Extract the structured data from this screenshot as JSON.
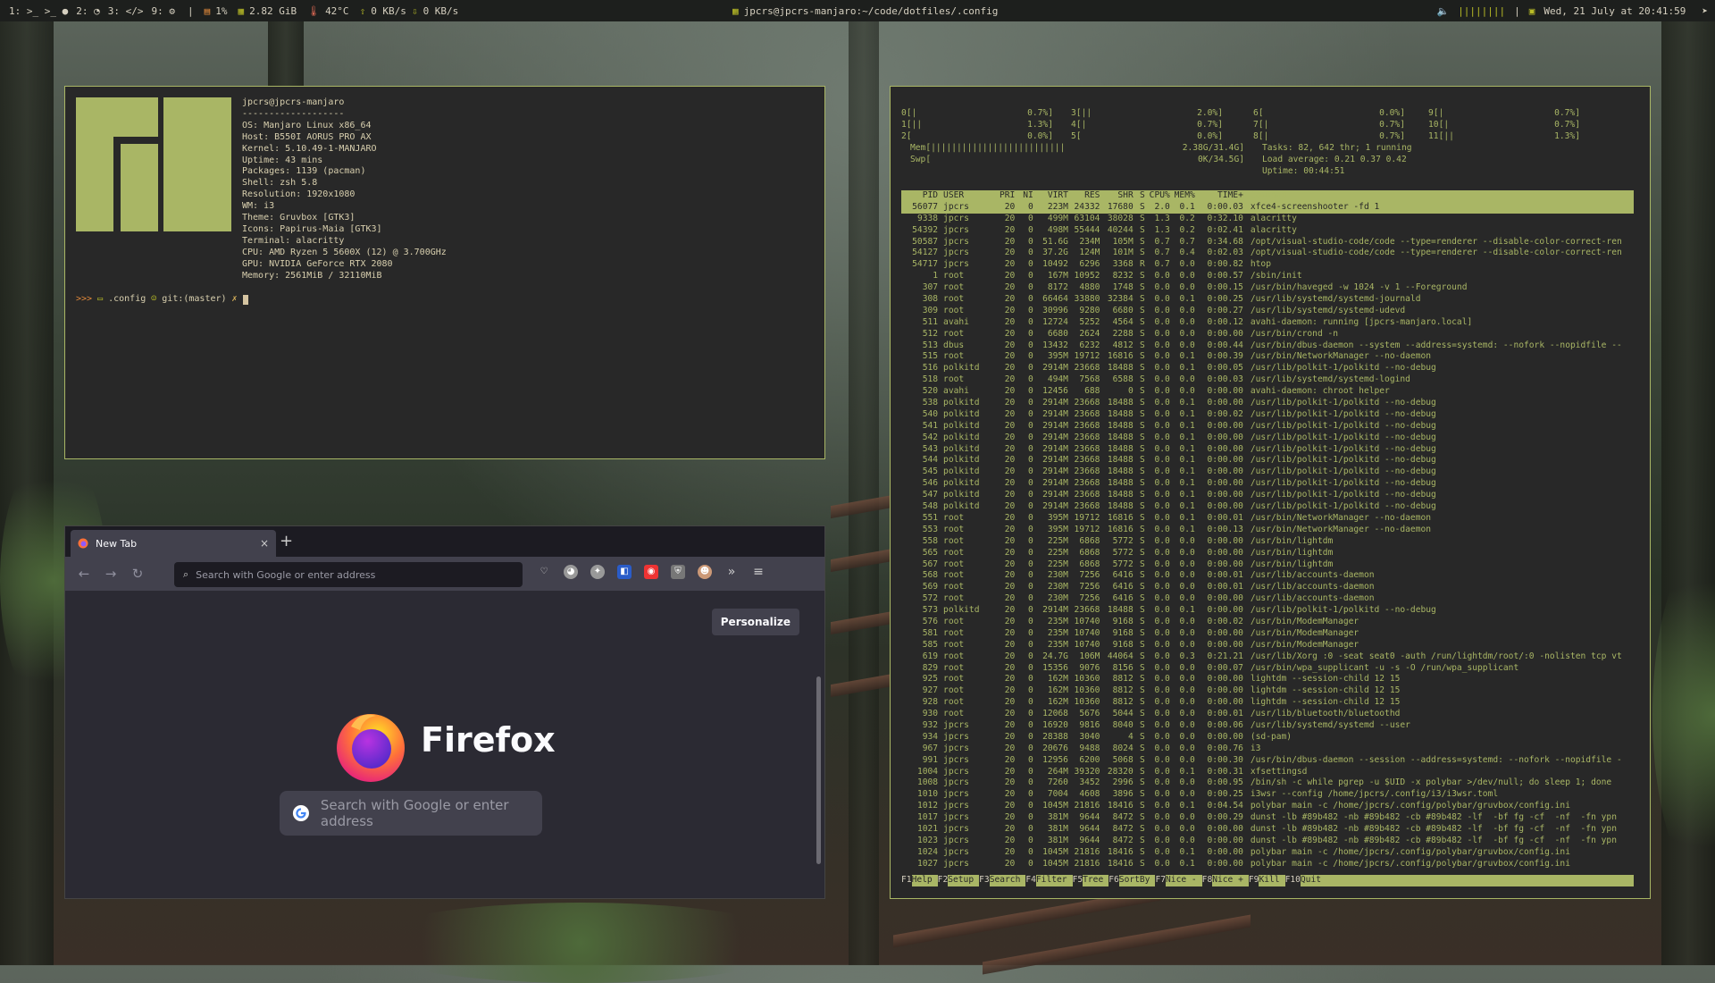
{
  "topbar": {
    "workspaces": [
      "1:",
      "2:",
      "3:",
      "9:"
    ],
    "cpu": "1%",
    "memory": "2.82 GiB",
    "temp": "42°C",
    "net_up": "0 KB/s",
    "net_down": "0 KB/s",
    "window_title": "jpcrs@jpcrs-manjaro:~/code/dotfiles/.config",
    "datetime": "Wed, 21 July at 20:41:59"
  },
  "terminal": {
    "user_host": "jpcrs@jpcrs-manjaro",
    "separator": "-------------------",
    "lines": [
      "OS: Manjaro Linux x86_64",
      "Host: B550I AORUS PRO AX",
      "Kernel: 5.10.49-1-MANJARO",
      "Uptime: 43 mins",
      "Packages: 1139 (pacman)",
      "Shell: zsh 5.8",
      "Resolution: 1920x1080",
      "WM: i3",
      "Theme: Gruvbox [GTK3]",
      "Icons: Papirus-Maia [GTK3]",
      "Terminal: alacritty",
      "CPU: AMD Ryzen 5 5600X (12) @ 3.700GHz",
      "GPU: NVIDIA GeForce RTX 2080",
      "Memory: 2561MiB / 32110MiB"
    ],
    "prompt_arrows": ">>>",
    "prompt_dir": ".config",
    "prompt_git": "git:(master)",
    "prompt_mark": "✗",
    "logo_color": "#a9b665"
  },
  "htop": {
    "cpu_meters": [
      {
        "id": "0",
        "bar": "[|",
        "pct": "0.7%]"
      },
      {
        "id": "1",
        "bar": "[||",
        "pct": "1.3%]"
      },
      {
        "id": "2",
        "bar": "[",
        "pct": "0.0%]"
      },
      {
        "id": "3",
        "bar": "[||",
        "pct": "2.0%]"
      },
      {
        "id": "4",
        "bar": "[|",
        "pct": "0.7%]"
      },
      {
        "id": "5",
        "bar": "[",
        "pct": "0.0%]"
      },
      {
        "id": "6",
        "bar": "[",
        "pct": "0.0%]"
      },
      {
        "id": "7",
        "bar": "[|",
        "pct": "0.7%]"
      },
      {
        "id": "8",
        "bar": "[|",
        "pct": "0.7%]"
      },
      {
        "id": "9",
        "bar": "[|",
        "pct": "0.7%]"
      },
      {
        "id": "10",
        "bar": "[|",
        "pct": "0.7%]"
      },
      {
        "id": "11",
        "bar": "[||",
        "pct": "1.3%]"
      }
    ],
    "mem_label": "Mem[",
    "mem_bar": "||||||||||||||||||||||||||",
    "mem_value": "2.38G/31.4G]",
    "swp_label": "Swp[",
    "swp_value": "0K/34.5G]",
    "tasks": "Tasks: 82, 642 thr; 1 running",
    "load": "Load average: 0.21 0.37 0.42",
    "uptime": "Uptime: 00:44:51",
    "headers": [
      "PID",
      "USER",
      "PRI",
      "NI",
      "VIRT",
      "RES",
      "SHR",
      "S",
      "CPU%",
      "MEM%",
      "TIME+",
      "Command"
    ],
    "rows": [
      [
        "56077",
        "jpcrs",
        "20",
        "0",
        "223M",
        "24332",
        "17680",
        "S",
        "2.0",
        "0.1",
        "0:00.03",
        "xfce4-screenshooter -fd 1"
      ],
      [
        "9338",
        "jpcrs",
        "20",
        "0",
        "499M",
        "63104",
        "38028",
        "S",
        "1.3",
        "0.2",
        "0:32.10",
        "alacritty"
      ],
      [
        "54392",
        "jpcrs",
        "20",
        "0",
        "498M",
        "55444",
        "40244",
        "S",
        "1.3",
        "0.2",
        "0:02.41",
        "alacritty"
      ],
      [
        "50587",
        "jpcrs",
        "20",
        "0",
        "51.6G",
        "234M",
        "105M",
        "S",
        "0.7",
        "0.7",
        "0:34.68",
        "/opt/visual-studio-code/code --type=renderer --disable-color-correct-ren"
      ],
      [
        "54127",
        "jpcrs",
        "20",
        "0",
        "37.2G",
        "124M",
        "101M",
        "S",
        "0.7",
        "0.4",
        "0:02.03",
        "/opt/visual-studio-code/code --type=renderer --disable-color-correct-ren"
      ],
      [
        "54717",
        "jpcrs",
        "20",
        "0",
        "10492",
        "6296",
        "3368",
        "R",
        "0.7",
        "0.0",
        "0:00.82",
        "htop"
      ],
      [
        "1",
        "root",
        "20",
        "0",
        "167M",
        "10952",
        "8232",
        "S",
        "0.0",
        "0.0",
        "0:00.57",
        "/sbin/init"
      ],
      [
        "307",
        "root",
        "20",
        "0",
        "8172",
        "4880",
        "1748",
        "S",
        "0.0",
        "0.0",
        "0:00.15",
        "/usr/bin/haveged -w 1024 -v 1 --Foreground"
      ],
      [
        "308",
        "root",
        "20",
        "0",
        "66464",
        "33880",
        "32384",
        "S",
        "0.0",
        "0.1",
        "0:00.25",
        "/usr/lib/systemd/systemd-journald"
      ],
      [
        "309",
        "root",
        "20",
        "0",
        "30996",
        "9280",
        "6680",
        "S",
        "0.0",
        "0.0",
        "0:00.27",
        "/usr/lib/systemd/systemd-udevd"
      ],
      [
        "511",
        "avahi",
        "20",
        "0",
        "12724",
        "5252",
        "4564",
        "S",
        "0.0",
        "0.0",
        "0:00.12",
        "avahi-daemon: running [jpcrs-manjaro.local]"
      ],
      [
        "512",
        "root",
        "20",
        "0",
        "6680",
        "2624",
        "2288",
        "S",
        "0.0",
        "0.0",
        "0:00.00",
        "/usr/bin/crond -n"
      ],
      [
        "513",
        "dbus",
        "20",
        "0",
        "13432",
        "6232",
        "4812",
        "S",
        "0.0",
        "0.0",
        "0:00.44",
        "/usr/bin/dbus-daemon --system --address=systemd: --nofork --nopidfile --"
      ],
      [
        "515",
        "root",
        "20",
        "0",
        "395M",
        "19712",
        "16816",
        "S",
        "0.0",
        "0.1",
        "0:00.39",
        "/usr/bin/NetworkManager --no-daemon"
      ],
      [
        "516",
        "polkitd",
        "20",
        "0",
        "2914M",
        "23668",
        "18488",
        "S",
        "0.0",
        "0.1",
        "0:00.05",
        "/usr/lib/polkit-1/polkitd --no-debug"
      ],
      [
        "518",
        "root",
        "20",
        "0",
        "494M",
        "7568",
        "6588",
        "S",
        "0.0",
        "0.0",
        "0:00.03",
        "/usr/lib/systemd/systemd-logind"
      ],
      [
        "520",
        "avahi",
        "20",
        "0",
        "12456",
        "688",
        "0",
        "S",
        "0.0",
        "0.0",
        "0:00.00",
        "avahi-daemon: chroot helper"
      ],
      [
        "538",
        "polkitd",
        "20",
        "0",
        "2914M",
        "23668",
        "18488",
        "S",
        "0.0",
        "0.1",
        "0:00.00",
        "/usr/lib/polkit-1/polkitd --no-debug"
      ],
      [
        "540",
        "polkitd",
        "20",
        "0",
        "2914M",
        "23668",
        "18488",
        "S",
        "0.0",
        "0.1",
        "0:00.02",
        "/usr/lib/polkit-1/polkitd --no-debug"
      ],
      [
        "541",
        "polkitd",
        "20",
        "0",
        "2914M",
        "23668",
        "18488",
        "S",
        "0.0",
        "0.1",
        "0:00.00",
        "/usr/lib/polkit-1/polkitd --no-debug"
      ],
      [
        "542",
        "polkitd",
        "20",
        "0",
        "2914M",
        "23668",
        "18488",
        "S",
        "0.0",
        "0.1",
        "0:00.00",
        "/usr/lib/polkit-1/polkitd --no-debug"
      ],
      [
        "543",
        "polkitd",
        "20",
        "0",
        "2914M",
        "23668",
        "18488",
        "S",
        "0.0",
        "0.1",
        "0:00.00",
        "/usr/lib/polkit-1/polkitd --no-debug"
      ],
      [
        "544",
        "polkitd",
        "20",
        "0",
        "2914M",
        "23668",
        "18488",
        "S",
        "0.0",
        "0.1",
        "0:00.00",
        "/usr/lib/polkit-1/polkitd --no-debug"
      ],
      [
        "545",
        "polkitd",
        "20",
        "0",
        "2914M",
        "23668",
        "18488",
        "S",
        "0.0",
        "0.1",
        "0:00.00",
        "/usr/lib/polkit-1/polkitd --no-debug"
      ],
      [
        "546",
        "polkitd",
        "20",
        "0",
        "2914M",
        "23668",
        "18488",
        "S",
        "0.0",
        "0.1",
        "0:00.00",
        "/usr/lib/polkit-1/polkitd --no-debug"
      ],
      [
        "547",
        "polkitd",
        "20",
        "0",
        "2914M",
        "23668",
        "18488",
        "S",
        "0.0",
        "0.1",
        "0:00.00",
        "/usr/lib/polkit-1/polkitd --no-debug"
      ],
      [
        "548",
        "polkitd",
        "20",
        "0",
        "2914M",
        "23668",
        "18488",
        "S",
        "0.0",
        "0.1",
        "0:00.00",
        "/usr/lib/polkit-1/polkitd --no-debug"
      ],
      [
        "551",
        "root",
        "20",
        "0",
        "395M",
        "19712",
        "16816",
        "S",
        "0.0",
        "0.1",
        "0:00.01",
        "/usr/bin/NetworkManager --no-daemon"
      ],
      [
        "553",
        "root",
        "20",
        "0",
        "395M",
        "19712",
        "16816",
        "S",
        "0.0",
        "0.1",
        "0:00.13",
        "/usr/bin/NetworkManager --no-daemon"
      ],
      [
        "558",
        "root",
        "20",
        "0",
        "225M",
        "6868",
        "5772",
        "S",
        "0.0",
        "0.0",
        "0:00.00",
        "/usr/bin/lightdm"
      ],
      [
        "565",
        "root",
        "20",
        "0",
        "225M",
        "6868",
        "5772",
        "S",
        "0.0",
        "0.0",
        "0:00.00",
        "/usr/bin/lightdm"
      ],
      [
        "567",
        "root",
        "20",
        "0",
        "225M",
        "6868",
        "5772",
        "S",
        "0.0",
        "0.0",
        "0:00.00",
        "/usr/bin/lightdm"
      ],
      [
        "568",
        "root",
        "20",
        "0",
        "230M",
        "7256",
        "6416",
        "S",
        "0.0",
        "0.0",
        "0:00.01",
        "/usr/lib/accounts-daemon"
      ],
      [
        "569",
        "root",
        "20",
        "0",
        "230M",
        "7256",
        "6416",
        "S",
        "0.0",
        "0.0",
        "0:00.01",
        "/usr/lib/accounts-daemon"
      ],
      [
        "572",
        "root",
        "20",
        "0",
        "230M",
        "7256",
        "6416",
        "S",
        "0.0",
        "0.0",
        "0:00.00",
        "/usr/lib/accounts-daemon"
      ],
      [
        "573",
        "polkitd",
        "20",
        "0",
        "2914M",
        "23668",
        "18488",
        "S",
        "0.0",
        "0.1",
        "0:00.00",
        "/usr/lib/polkit-1/polkitd --no-debug"
      ],
      [
        "576",
        "root",
        "20",
        "0",
        "235M",
        "10740",
        "9168",
        "S",
        "0.0",
        "0.0",
        "0:00.02",
        "/usr/bin/ModemManager"
      ],
      [
        "581",
        "root",
        "20",
        "0",
        "235M",
        "10740",
        "9168",
        "S",
        "0.0",
        "0.0",
        "0:00.00",
        "/usr/bin/ModemManager"
      ],
      [
        "585",
        "root",
        "20",
        "0",
        "235M",
        "10740",
        "9168",
        "S",
        "0.0",
        "0.0",
        "0:00.00",
        "/usr/bin/ModemManager"
      ],
      [
        "619",
        "root",
        "20",
        "0",
        "24.7G",
        "106M",
        "44064",
        "S",
        "0.0",
        "0.3",
        "0:21.21",
        "/usr/lib/Xorg :0 -seat seat0 -auth /run/lightdm/root/:0 -nolisten tcp vt"
      ],
      [
        "829",
        "root",
        "20",
        "0",
        "15356",
        "9076",
        "8156",
        "S",
        "0.0",
        "0.0",
        "0:00.07",
        "/usr/bin/wpa_supplicant -u -s -O /run/wpa_supplicant"
      ],
      [
        "925",
        "root",
        "20",
        "0",
        "162M",
        "10360",
        "8812",
        "S",
        "0.0",
        "0.0",
        "0:00.00",
        "lightdm --session-child 12 15"
      ],
      [
        "927",
        "root",
        "20",
        "0",
        "162M",
        "10360",
        "8812",
        "S",
        "0.0",
        "0.0",
        "0:00.00",
        "lightdm --session-child 12 15"
      ],
      [
        "928",
        "root",
        "20",
        "0",
        "162M",
        "10360",
        "8812",
        "S",
        "0.0",
        "0.0",
        "0:00.00",
        "lightdm --session-child 12 15"
      ],
      [
        "930",
        "root",
        "20",
        "0",
        "12068",
        "5676",
        "5044",
        "S",
        "0.0",
        "0.0",
        "0:00.01",
        "/usr/lib/bluetooth/bluetoothd"
      ],
      [
        "932",
        "jpcrs",
        "20",
        "0",
        "16920",
        "9816",
        "8040",
        "S",
        "0.0",
        "0.0",
        "0:00.06",
        "/usr/lib/systemd/systemd --user"
      ],
      [
        "934",
        "jpcrs",
        "20",
        "0",
        "28388",
        "3040",
        "4",
        "S",
        "0.0",
        "0.0",
        "0:00.00",
        "(sd-pam)"
      ],
      [
        "967",
        "jpcrs",
        "20",
        "0",
        "20676",
        "9488",
        "8024",
        "S",
        "0.0",
        "0.0",
        "0:00.76",
        "i3"
      ],
      [
        "991",
        "jpcrs",
        "20",
        "0",
        "12956",
        "6200",
        "5068",
        "S",
        "0.0",
        "0.0",
        "0:00.30",
        "/usr/bin/dbus-daemon --session --address=systemd: --nofork --nopidfile -"
      ],
      [
        "1004",
        "jpcrs",
        "20",
        "0",
        "264M",
        "39320",
        "28320",
        "S",
        "0.0",
        "0.1",
        "0:00.31",
        "xfsettingsd"
      ],
      [
        "1008",
        "jpcrs",
        "20",
        "0",
        "7260",
        "3452",
        "2996",
        "S",
        "0.0",
        "0.0",
        "0:00.95",
        "/bin/sh -c while pgrep -u $UID -x polybar >/dev/null; do sleep 1; done"
      ],
      [
        "1010",
        "jpcrs",
        "20",
        "0",
        "7004",
        "4608",
        "3896",
        "S",
        "0.0",
        "0.0",
        "0:00.25",
        "i3wsr --config /home/jpcrs/.config/i3/i3wsr.toml"
      ],
      [
        "1012",
        "jpcrs",
        "20",
        "0",
        "1045M",
        "21816",
        "18416",
        "S",
        "0.0",
        "0.1",
        "0:04.54",
        "polybar main -c /home/jpcrs/.config/polybar/gruvbox/config.ini"
      ],
      [
        "1017",
        "jpcrs",
        "20",
        "0",
        "381M",
        "9644",
        "8472",
        "S",
        "0.0",
        "0.0",
        "0:00.29",
        "dunst -lb #89b482 -nb #89b482 -cb #89b482 -lf  -bf fg -cf  -nf  -fn ypn"
      ],
      [
        "1021",
        "jpcrs",
        "20",
        "0",
        "381M",
        "9644",
        "8472",
        "S",
        "0.0",
        "0.0",
        "0:00.00",
        "dunst -lb #89b482 -nb #89b482 -cb #89b482 -lf  -bf fg -cf  -nf  -fn ypn"
      ],
      [
        "1023",
        "jpcrs",
        "20",
        "0",
        "381M",
        "9644",
        "8472",
        "S",
        "0.0",
        "0.0",
        "0:00.00",
        "dunst -lb #89b482 -nb #89b482 -cb #89b482 -lf  -bf fg -cf  -nf  -fn ypn"
      ],
      [
        "1024",
        "jpcrs",
        "20",
        "0",
        "1045M",
        "21816",
        "18416",
        "S",
        "0.0",
        "0.1",
        "0:00.00",
        "polybar main -c /home/jpcrs/.config/polybar/gruvbox/config.ini"
      ],
      [
        "1027",
        "jpcrs",
        "20",
        "0",
        "1045M",
        "21816",
        "18416",
        "S",
        "0.0",
        "0.1",
        "0:00.00",
        "polybar main -c /home/jpcrs/.config/polybar/gruvbox/config.ini"
      ]
    ],
    "fkeys": [
      {
        "key": "F1",
        "label": "Help"
      },
      {
        "key": "F2",
        "label": "Setup"
      },
      {
        "key": "F3",
        "label": "Search"
      },
      {
        "key": "F4",
        "label": "Filter"
      },
      {
        "key": "F5",
        "label": "Tree"
      },
      {
        "key": "F6",
        "label": "SortBy"
      },
      {
        "key": "F7",
        "label": "Nice -"
      },
      {
        "key": "F8",
        "label": "Nice +"
      },
      {
        "key": "F9",
        "label": "Kill"
      },
      {
        "key": "F10",
        "label": "Quit"
      }
    ]
  },
  "firefox": {
    "tab_title": "New Tab",
    "tab_close": "×",
    "new_tab": "+",
    "url_placeholder": "Search with Google or enter address",
    "personalize": "Personalize",
    "wordmark": "Firefox",
    "search_placeholder": "Search with Google or enter address",
    "overflow": "»",
    "menu": "≡"
  }
}
